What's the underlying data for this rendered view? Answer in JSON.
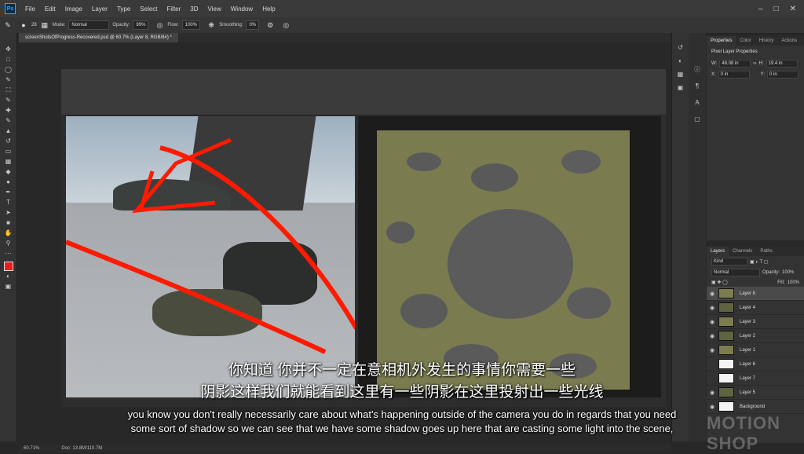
{
  "menubar": {
    "logo": "Ps",
    "items": [
      "File",
      "Edit",
      "Image",
      "Layer",
      "Type",
      "Select",
      "Filter",
      "3D",
      "View",
      "Window",
      "Help"
    ]
  },
  "options": {
    "mode_label": "Mode:",
    "mode_value": "Normal",
    "opacity_label": "Opacity:",
    "opacity_value": "99%",
    "flow_label": "Flow:",
    "flow_value": "100%",
    "smoothing_label": "Smoothing:",
    "smoothing_value": "0%",
    "brush_size": "28"
  },
  "document_tab": "screenShotsOfProgress-Recovered.psd @ 60.7% (Layer 8, RGB/8#) *",
  "properties": {
    "tabs": [
      "Properties",
      "Color",
      "History",
      "Actions"
    ],
    "title": "Pixel Layer Properties",
    "w_label": "W:",
    "w_value": "48.08 in",
    "h_label": "H:",
    "h_value": "19.4 in",
    "x_label": "X:",
    "x_value": "0 in",
    "y_label": "Y:",
    "y_value": "0 in"
  },
  "layers_panel": {
    "tabs": [
      "Layers",
      "Channels",
      "Paths"
    ],
    "kind": "Kind",
    "blend": "Normal",
    "opacity_label": "Opacity:",
    "opacity_value": "100%",
    "fill_label": "Fill:",
    "fill_value": "100%",
    "layers": [
      {
        "name": "Layer 8",
        "selected": true
      },
      {
        "name": "Layer 4",
        "selected": false
      },
      {
        "name": "Layer 3",
        "selected": false
      },
      {
        "name": "Layer 2",
        "selected": false
      },
      {
        "name": "Layer 1",
        "selected": false
      },
      {
        "name": "Layer 6",
        "selected": false
      },
      {
        "name": "Layer 7",
        "selected": false
      },
      {
        "name": "Layer 5",
        "selected": false
      },
      {
        "name": "Background",
        "selected": false
      }
    ]
  },
  "subtitles": {
    "zh_line1": "你知道 你并不一定在意相机外发生的事情你需要一些",
    "zh_line2": "阴影这样我们就能看到这里有一些阴影在这里投射出一些光线",
    "en_line1": "you know you don't really necessarily care about what's happening outside of the camera you do in regards that you need",
    "en_line2": "some sort of shadow so we can see that we have some shadow goes up here that are casting some light into the scene,"
  },
  "status": {
    "zoom": "60.71%",
    "doc": "Doc: 13.8M/110.7M"
  },
  "watermark": "MOTION SHOP"
}
